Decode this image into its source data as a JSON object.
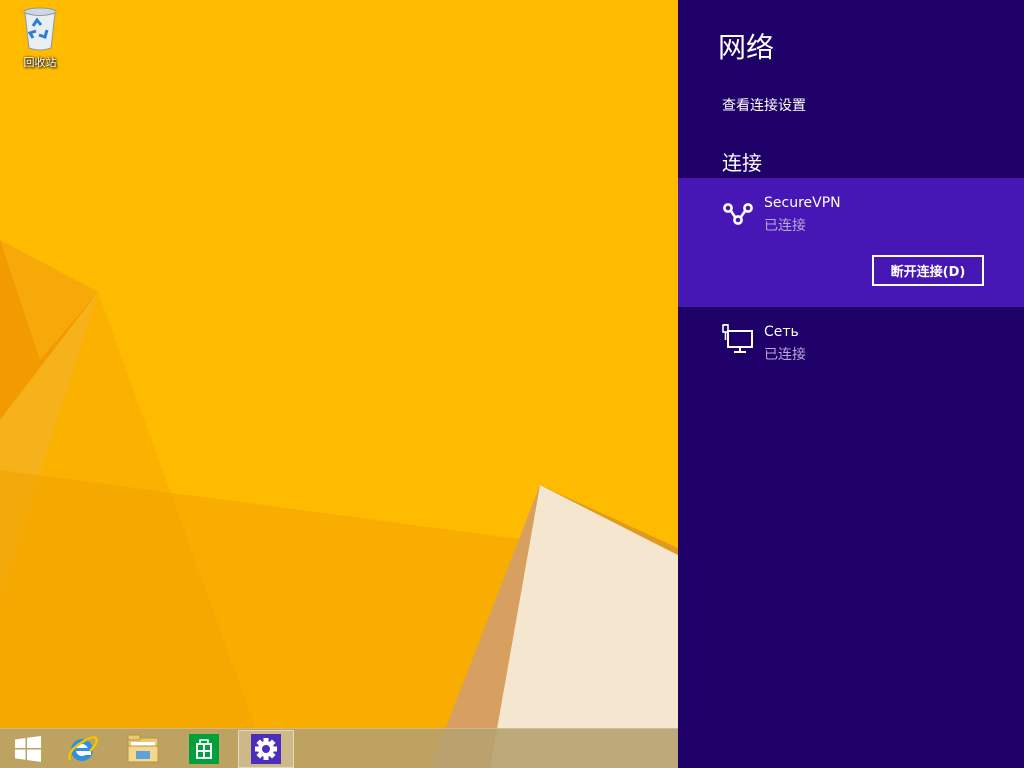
{
  "desktop": {
    "recycle_bin": {
      "label": "回收站",
      "icon": "recycle-bin-icon"
    }
  },
  "taskbar": {
    "items": [
      {
        "name": "start",
        "icon": "windows-logo-icon"
      },
      {
        "name": "internet-explorer",
        "icon": "internet-explorer-icon"
      },
      {
        "name": "file-explorer",
        "icon": "folder-icon"
      },
      {
        "name": "store",
        "icon": "store-icon"
      },
      {
        "name": "settings",
        "icon": "gear-icon",
        "active": true
      }
    ]
  },
  "network_pane": {
    "title": "网络",
    "view_settings_link": "查看连接设置",
    "section_heading": "连接",
    "connections": [
      {
        "name": "SecureVPN",
        "status": "已连接",
        "icon": "vpn-icon",
        "selected": true,
        "button_label": "断开连接(D)"
      },
      {
        "name": "Сеть",
        "status": "已连接",
        "icon": "wired-network-icon",
        "selected": false
      }
    ]
  },
  "colors": {
    "wallpaper": "#FFBB00",
    "charm_background": "#1F0068",
    "selected_item": "#4617B4",
    "status_text": "#B7A8DC"
  }
}
